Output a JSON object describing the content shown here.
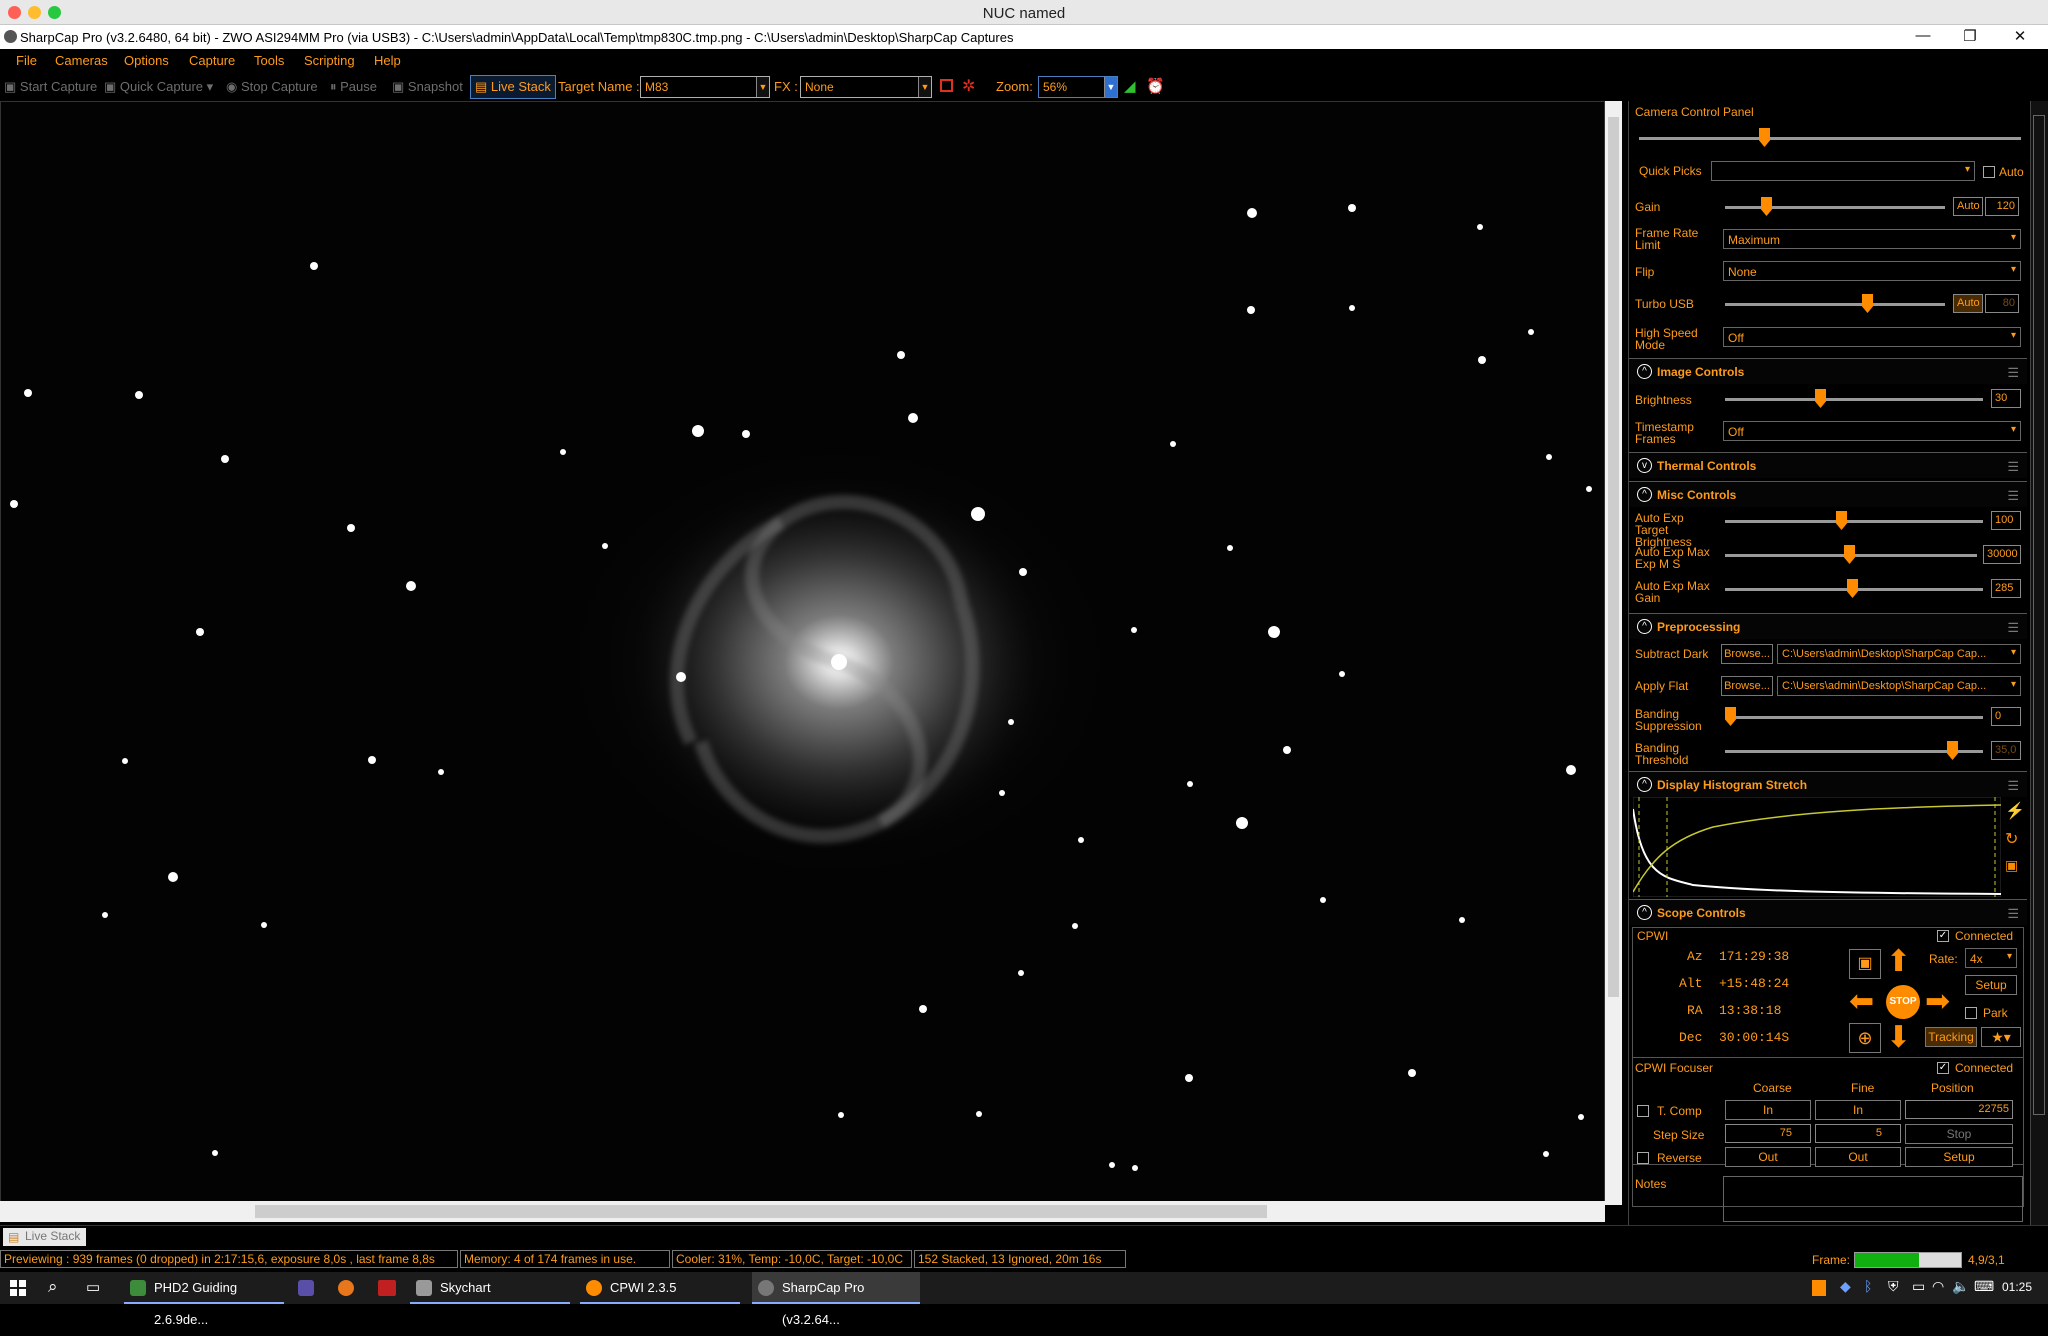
{
  "mac": {
    "title": "NUC named"
  },
  "window": {
    "title": "SharpCap Pro (v3.2.6480, 64 bit) - ZWO ASI294MM Pro (via USB3) - C:\\Users\\admin\\AppData\\Local\\Temp\\tmp830C.tmp.png - C:\\Users\\admin\\Desktop\\SharpCap Captures",
    "min": "—",
    "restore": "❐",
    "close": "✕"
  },
  "menu": [
    "File",
    "Cameras",
    "Options",
    "Capture",
    "Tools",
    "Scripting",
    "Help"
  ],
  "toolbar": {
    "start_capture": "Start Capture",
    "quick_capture": "Quick Capture",
    "stop_capture": "Stop Capture",
    "pause": "Pause",
    "snapshot": "Snapshot",
    "live_stack": "Live Stack",
    "target_label": "Target Name :",
    "target_value": "M83",
    "fx_label": "FX :",
    "fx_value": "None",
    "zoom_label": "Zoom:",
    "zoom_value": "56%"
  },
  "panel": {
    "title": "Camera Control Panel",
    "quick_picks": "Quick Picks",
    "auto": "Auto",
    "gain_label": "Gain",
    "gain_auto": "Auto",
    "gain_value": "120",
    "gain_level": 0.2,
    "frame_rate_label": "Frame Rate Limit",
    "frame_rate_value": "Maximum",
    "flip_label": "Flip",
    "flip_value": "None",
    "turbo_label": "Turbo USB",
    "turbo_auto": "Auto",
    "turbo_value": "80",
    "high_speed_label": "High Speed Mode",
    "high_speed_value": "Off",
    "image_controls": "Image Controls",
    "brightness_label": "Brightness",
    "brightness_value": "30",
    "timestamp_label": "Timestamp Frames",
    "timestamp_value": "Off",
    "thermal_controls": "Thermal Controls",
    "misc_controls": "Misc Controls",
    "auto_exp_target_label": "Auto Exp Target Brightness",
    "auto_exp_target_value": "100",
    "auto_exp_max_label": "Auto Exp Max Exp M S",
    "auto_exp_max_value": "30000",
    "auto_exp_gain_label": "Auto Exp Max Gain",
    "auto_exp_gain_value": "285",
    "preprocessing": "Preprocessing",
    "subtract_dark_label": "Subtract Dark",
    "apply_flat_label": "Apply Flat",
    "browse": "Browse...",
    "dark_path": "C:\\Users\\admin\\Desktop\\SharpCap Cap...",
    "flat_path": "C:\\Users\\admin\\Desktop\\SharpCap Cap...",
    "banding_supp_label": "Banding Suppression",
    "banding_supp_value": "0",
    "banding_thresh_label": "Banding Threshold",
    "banding_thresh_value": "35,0",
    "histogram": "Display Histogram Stretch",
    "scope_controls": "Scope Controls",
    "cpwi": "CPWI",
    "connected": "Connected",
    "az_label": "Az",
    "az_value": "171:29:38",
    "alt_label": "Alt",
    "alt_value": "+15:48:24",
    "ra_label": "RA",
    "ra_value": "13:38:18",
    "dec_label": "Dec",
    "dec_value": "30:00:14S",
    "rate_label": "Rate:",
    "rate_value": "4x",
    "setup": "Setup",
    "park": "Park",
    "tracking": "Tracking",
    "stop": "STOP",
    "focuser": "CPWI Focuser",
    "focuser_connected": "Connected",
    "coarse": "Coarse",
    "fine": "Fine",
    "position": "Position",
    "tcomp": "T. Comp",
    "in": "In",
    "position_value": "22755",
    "step_size_label": "Step Size",
    "step_coarse": "75",
    "step_fine": "5",
    "stop_btn": "Stop",
    "reverse": "Reverse",
    "out": "Out",
    "focuser_setup": "Setup",
    "notes": "Notes"
  },
  "tab": {
    "live_stack": "Live Stack"
  },
  "status": {
    "previewing": "Previewing : 939 frames (0 dropped) in 2:17:15,6, exposure 8,0s , last frame 8,8s",
    "memory": "Memory: 4 of 174 frames in use.",
    "cooler": "Cooler: 31%, Temp: -10,0C, Target: -10,0C",
    "stacked": "152 Stacked, 13 Ignored, 20m 16s",
    "frame_label": "Frame:",
    "frame_value": "4,9/3,1",
    "frame_level": 0.6
  },
  "taskbar": {
    "items": [
      "PHD2 Guiding 2.6.9de...",
      "Skychart",
      "CPWI 2.3.5",
      "SharpCap Pro (v3.2.64..."
    ],
    "time": "01:25"
  }
}
